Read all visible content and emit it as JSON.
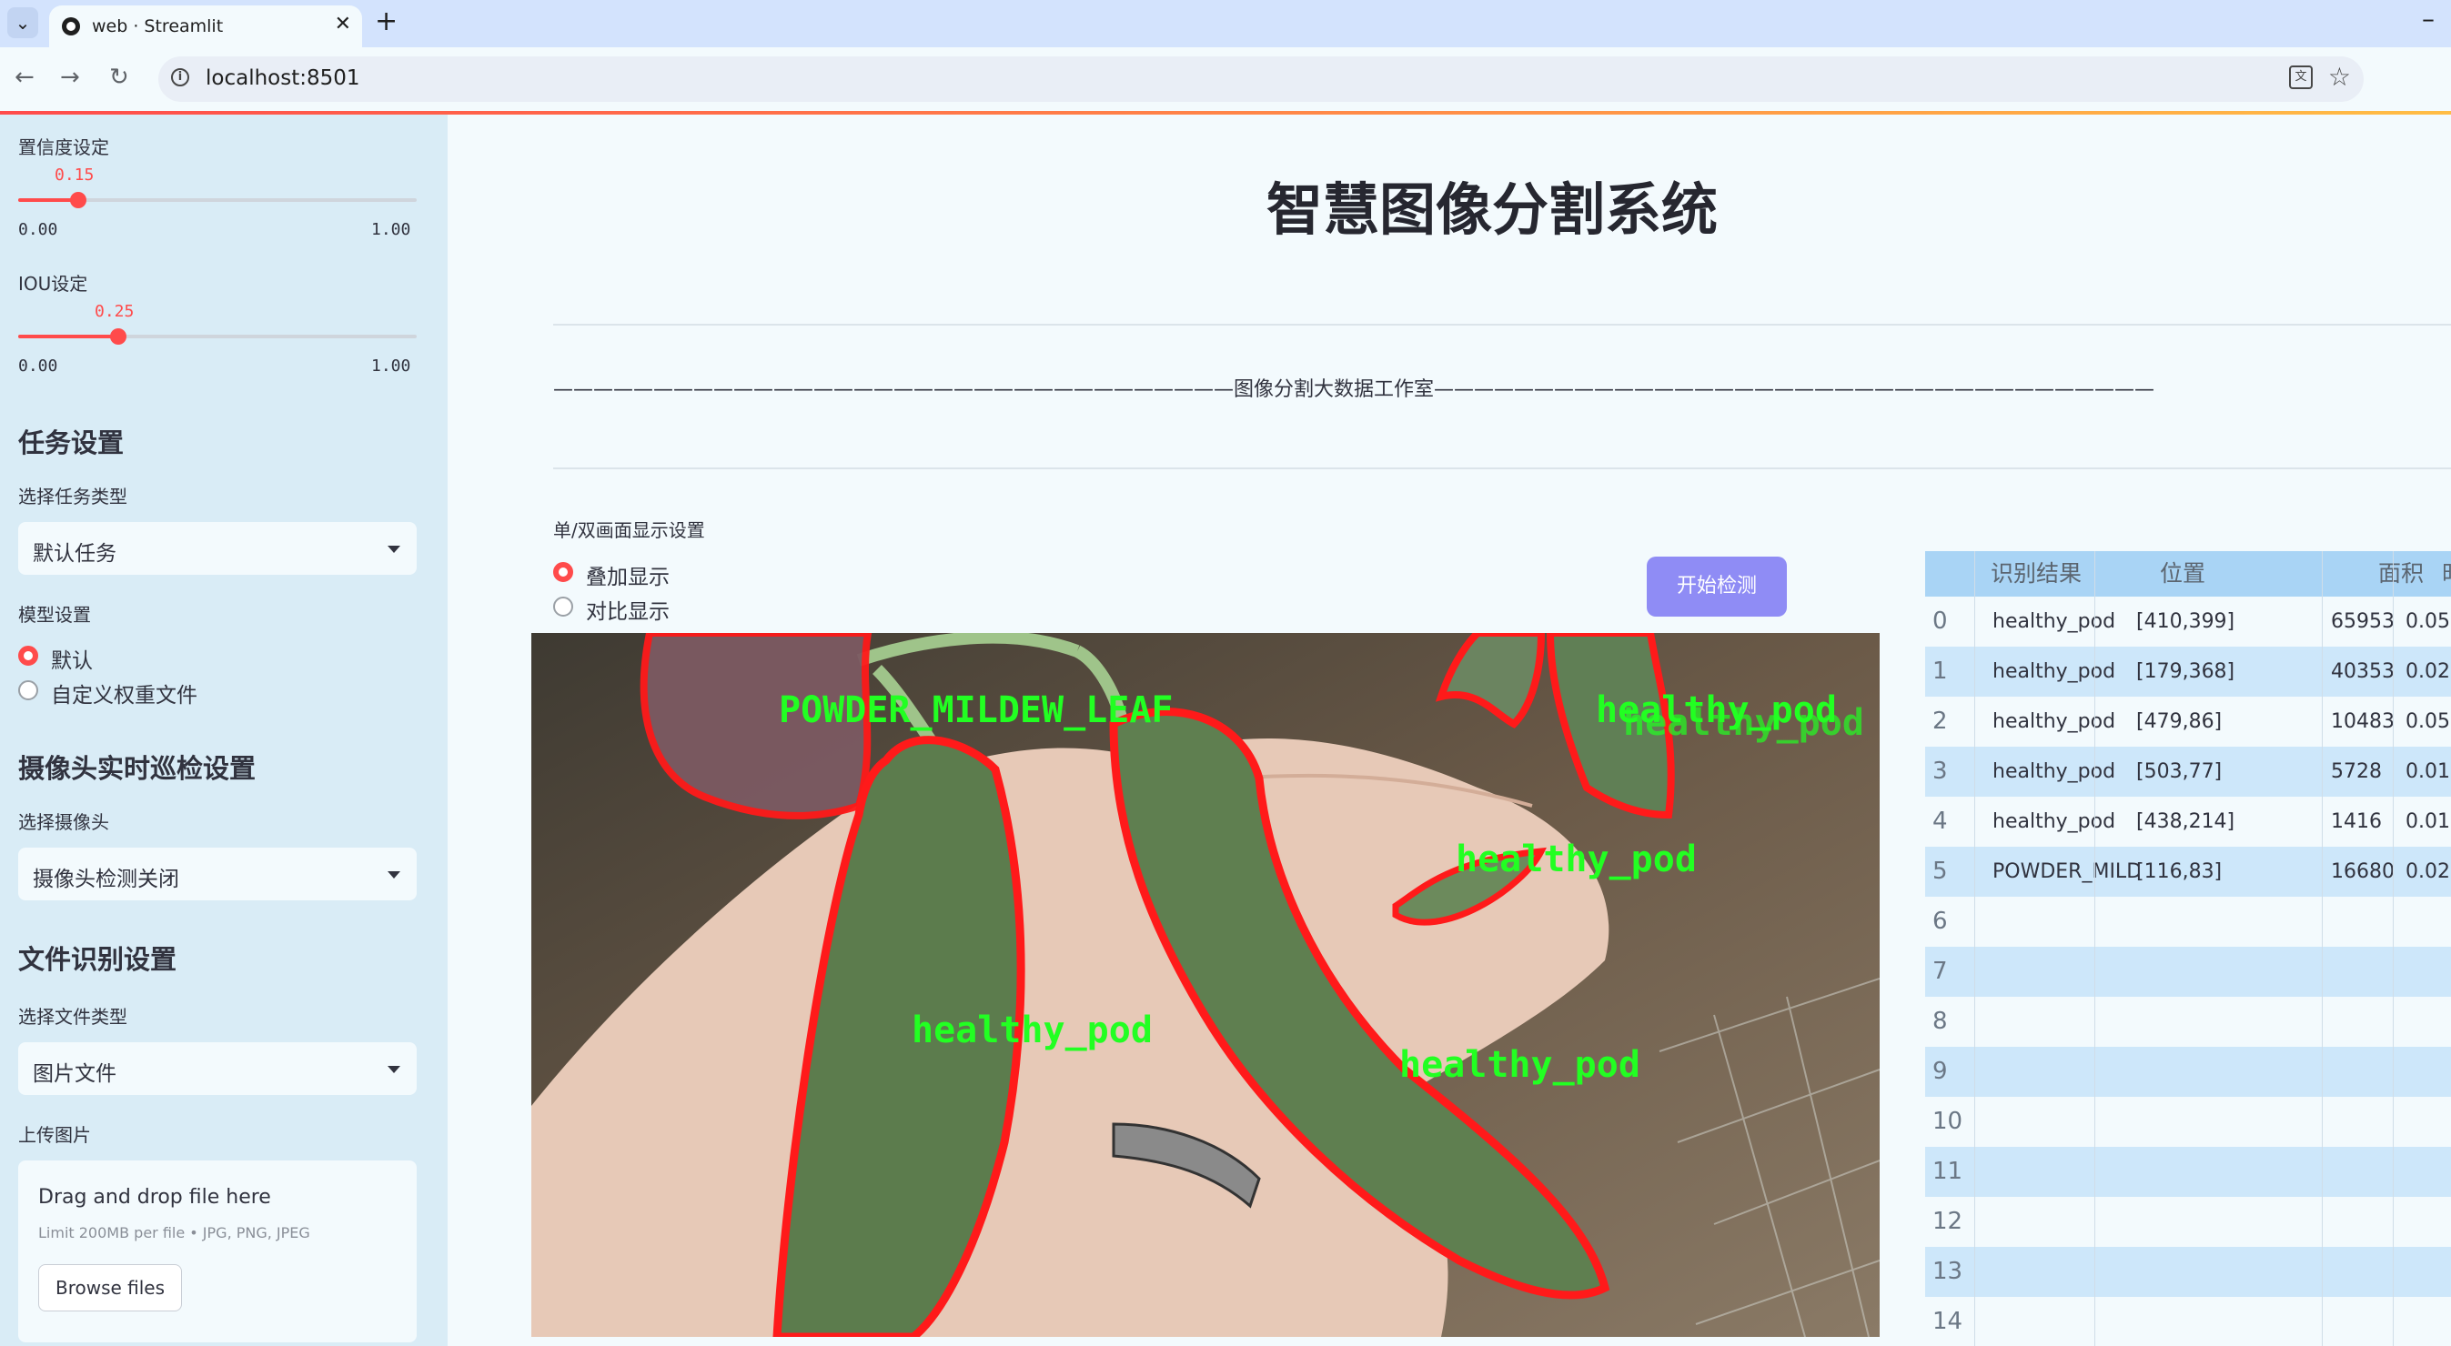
{
  "browser": {
    "tab_title": "web · Streamlit",
    "url": "localhost:8501"
  },
  "sidebar": {
    "confidence": {
      "label": "置信度设定",
      "value": "0.15",
      "value_num": 0.15,
      "min": "0.00",
      "max": "1.00"
    },
    "iou": {
      "label": "IOU设定",
      "value": "0.25",
      "value_num": 0.25,
      "min": "0.00",
      "max": "1.00"
    },
    "task_section": "任务设置",
    "task_type_label": "选择任务类型",
    "task_type_value": "默认任务",
    "model_label": "模型设置",
    "model_options": [
      "默认",
      "自定义权重文件"
    ],
    "model_selected": "默认",
    "camera_section": "摄像头实时巡检设置",
    "camera_label": "选择摄像头",
    "camera_value": "摄像头检测关闭",
    "file_section": "文件识别设置",
    "file_type_label": "选择文件类型",
    "file_type_value": "图片文件",
    "upload_label": "上传图片",
    "upload_title": "Drag and drop file here",
    "upload_hint": "Limit 200MB per file • JPG, PNG, JPEG",
    "browse_label": "Browse files"
  },
  "main": {
    "title": "智慧图像分割系统",
    "subtitle_line": "——————————————————————————————————图像分割大数据工作室————————————————————————————————————",
    "display_mode_label": "单/双画面显示设置",
    "display_options": [
      "叠加显示",
      "对比显示"
    ],
    "display_selected": "叠加显示",
    "start_button": "开始检测",
    "overlay_labels": [
      "POWDER_MILDEW_LEAF",
      "healthy_pod",
      "healthy_pod",
      "healthy_pod",
      "healthy_pod",
      "healthy_pod"
    ]
  },
  "colors": {
    "accent": "#ff4b4b",
    "button": "#8f8cf5",
    "sidebar_bg": "#d9ecf6",
    "table_header": "#a9d4f5",
    "mask_outline": "#ff1a1a",
    "label_green": "#22ff22"
  },
  "table": {
    "headers": [
      "",
      "识别结果",
      "位置",
      "面积",
      "时间"
    ],
    "rows": [
      {
        "idx": "0",
        "result": "healthy_pod",
        "pos": "[410,399]",
        "area": "65953",
        "time": "0.05"
      },
      {
        "idx": "1",
        "result": "healthy_pod",
        "pos": "[179,368]",
        "area": "40353",
        "time": "0.02"
      },
      {
        "idx": "2",
        "result": "healthy_pod",
        "pos": "[479,86]",
        "area": "10483",
        "time": "0.05"
      },
      {
        "idx": "3",
        "result": "healthy_pod",
        "pos": "[503,77]",
        "area": "5728",
        "time": "0.01"
      },
      {
        "idx": "4",
        "result": "healthy_pod",
        "pos": "[438,214]",
        "area": "1416",
        "time": "0.01"
      },
      {
        "idx": "5",
        "result": "POWDER_MILDEW_LEAF",
        "pos": "[116,83]",
        "area": "16680",
        "time": "0.02"
      },
      {
        "idx": "6"
      },
      {
        "idx": "7"
      },
      {
        "idx": "8"
      },
      {
        "idx": "9"
      },
      {
        "idx": "10"
      },
      {
        "idx": "11"
      },
      {
        "idx": "12"
      },
      {
        "idx": "13"
      },
      {
        "idx": "14"
      }
    ]
  }
}
